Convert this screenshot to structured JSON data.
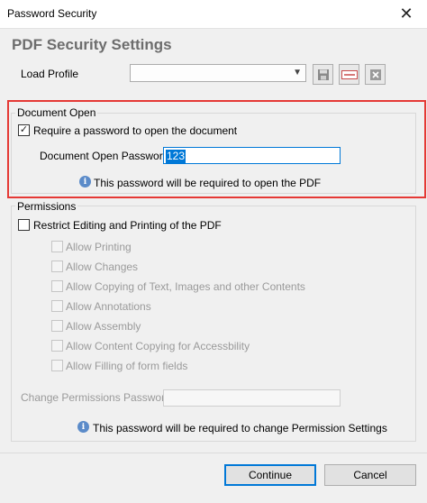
{
  "window": {
    "title": "Password Security",
    "close_glyph": "✕"
  },
  "heading": "PDF Security Settings",
  "load_profile": {
    "label": "Load Profile",
    "value": "",
    "buttons": [
      {
        "icon": "save-icon"
      },
      {
        "icon": "rename-icon"
      },
      {
        "icon": "delete-icon"
      }
    ]
  },
  "document_open": {
    "group_title": "Document Open",
    "require_label": "Require a password to open the document",
    "require_checked": true,
    "password_label": "Document Open Password:",
    "password_value": "123",
    "info_text": "This password will be required to open the PDF"
  },
  "permissions": {
    "group_title": "Permissions",
    "restrict_label": "Restrict Editing and Printing of the PDF",
    "restrict_checked": false,
    "options": [
      "Allow Printing",
      "Allow Changes",
      "Allow Copying of Text, Images and other Contents",
      "Allow Annotations",
      "Allow Assembly",
      "Allow Content Copying for Accessbility",
      "Allow Filling of form fields"
    ],
    "change_password_label": "Change Permissions Password:",
    "change_password_value": "",
    "info_text": "This password will be required to change Permission Settings"
  },
  "buttons": {
    "continue": "Continue",
    "cancel": "Cancel"
  },
  "colors": {
    "highlight": "#e53935",
    "accent": "#0078d7",
    "info": "#5b8bc9"
  }
}
